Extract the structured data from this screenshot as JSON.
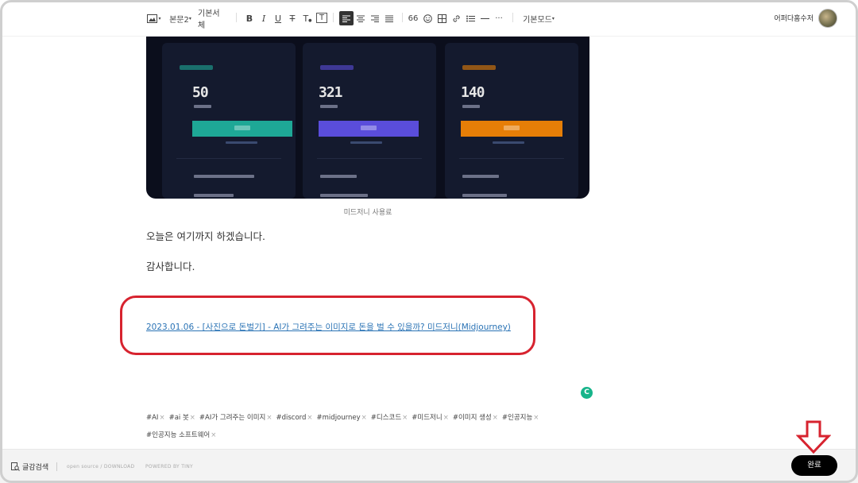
{
  "toolbar": {
    "image_icon": "image-icon",
    "paragraph_style": "본문2",
    "font_family": "기본서체",
    "bold": "B",
    "italic": "I",
    "underline": "U",
    "strike": "T",
    "text_color": "T",
    "text_bg": "T",
    "quote": "66",
    "mode": "기본모드"
  },
  "user": {
    "name": "어퍼다홈수저"
  },
  "pricing_image": {
    "cards": [
      {
        "price": "50",
        "accent": "#1ea896"
      },
      {
        "price": "321",
        "accent": "#5a4ddb"
      },
      {
        "price": "140",
        "accent": "#e67e07"
      }
    ],
    "caption": "미드저니 사용료"
  },
  "body": {
    "line1": "오늘은 여기까지 하겠습니다.",
    "line2": "감사합니다.",
    "link_text": "2023.01.06 - [사진으로 돈벌기] - AI가 그려주는 이미지로 돈을 벌 수 있을까? 미드저니(Midjourney)"
  },
  "grammarly_icon": "grammarly-icon",
  "tags": [
    "#AI",
    "#ai 봇",
    "#AI가 그려주는 이미지",
    "#discord",
    "#midjourney",
    "#디스코드",
    "#미드저니",
    "#이미지 생성",
    "#인공지능",
    "#인공지능 소프트웨어"
  ],
  "footer": {
    "spellcheck": "글감검색",
    "open_source": "open source / DOWNLOAD",
    "powered": "POWERED BY TINY",
    "done_label": "완료"
  },
  "colors": {
    "highlight_border": "#d7232f",
    "link": "#2a73b5",
    "done_bg": "#000000"
  }
}
